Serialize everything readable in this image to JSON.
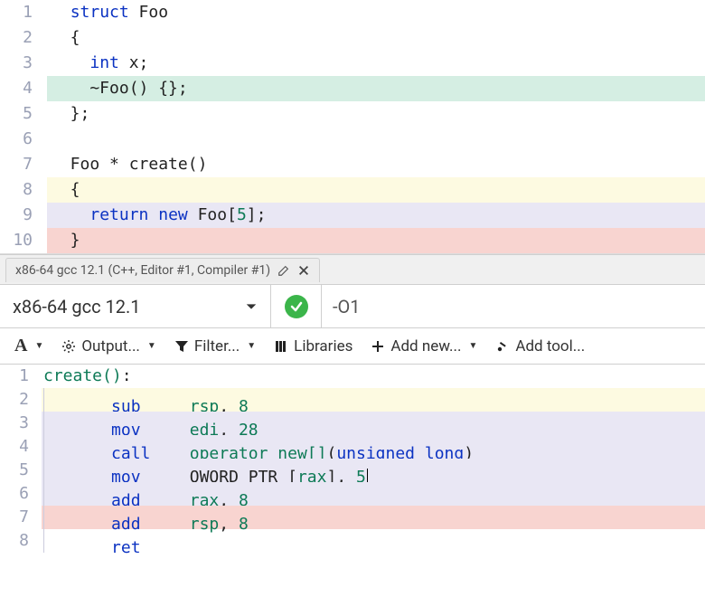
{
  "editor": {
    "lines": [
      {
        "n": "1",
        "bg": "",
        "html": "<span class='kw'>struct</span> Foo"
      },
      {
        "n": "2",
        "bg": "",
        "html": "{"
      },
      {
        "n": "3",
        "bg": "",
        "html": "  <span class='kw'>int</span> x;"
      },
      {
        "n": "4",
        "bg": "hl-green",
        "html": "  ~Foo() {};"
      },
      {
        "n": "5",
        "bg": "",
        "html": "};"
      },
      {
        "n": "6",
        "bg": "",
        "html": ""
      },
      {
        "n": "7",
        "bg": "",
        "html": "Foo * <span class='fn'>create</span>()"
      },
      {
        "n": "8",
        "bg": "hl-yellow",
        "html": "{"
      },
      {
        "n": "9",
        "bg": "hl-lav",
        "html": "  <span class='kw'>return</span> <span class='kw'>new</span> Foo[<span class='nm'>5</span>];"
      },
      {
        "n": "10",
        "bg": "hl-red",
        "html": "}"
      }
    ]
  },
  "tab": {
    "label": "x86-64 gcc 12.1 (C++, Editor #1, Compiler #1)"
  },
  "compiler": {
    "name": "x86-64 gcc 12.1",
    "flags": "-O1"
  },
  "toolbar": {
    "font": "A",
    "output": "Output...",
    "filter": "Filter...",
    "libraries": "Libraries",
    "add_new": "Add new...",
    "add_tool": "Add tool..."
  },
  "asm": {
    "lines": [
      {
        "n": "1",
        "bg": "",
        "html": "<span class='call'>create()</span>:"
      },
      {
        "n": "2",
        "bg": "hl-yellow",
        "indent": true,
        "html": "<span class='asm-op'>sub</span>     <span class='reg'>rsp</span>, <span class='nm'>8</span>"
      },
      {
        "n": "3",
        "bg": "hl-lav",
        "indent": true,
        "html": "<span class='asm-op'>mov</span>     <span class='reg'>edi</span>, <span class='nm'>28</span>"
      },
      {
        "n": "4",
        "bg": "hl-lav",
        "indent": true,
        "html": "<span class='asm-op'>call</span>    <span class='call'>operator new[]</span>(<span class='kw'>unsigned</span> <span class='kw'>long</span>)"
      },
      {
        "n": "5",
        "bg": "hl-lav",
        "indent": true,
        "html": "<span class='asm-op'>mov</span>     QWORD PTR [<span class='reg'>rax</span>], <span class='nm'>5</span><span class='cursor'></span>"
      },
      {
        "n": "6",
        "bg": "hl-lav",
        "indent": true,
        "html": "<span class='asm-op'>add</span>     <span class='reg'>rax</span>, <span class='nm'>8</span>"
      },
      {
        "n": "7",
        "bg": "hl-red",
        "indent": true,
        "html": "<span class='asm-op'>add</span>     <span class='reg'>rsp</span>, <span class='nm'>8</span>"
      },
      {
        "n": "8",
        "bg": "",
        "indent": true,
        "html": "<span class='asm-op'>ret</span>"
      }
    ]
  }
}
